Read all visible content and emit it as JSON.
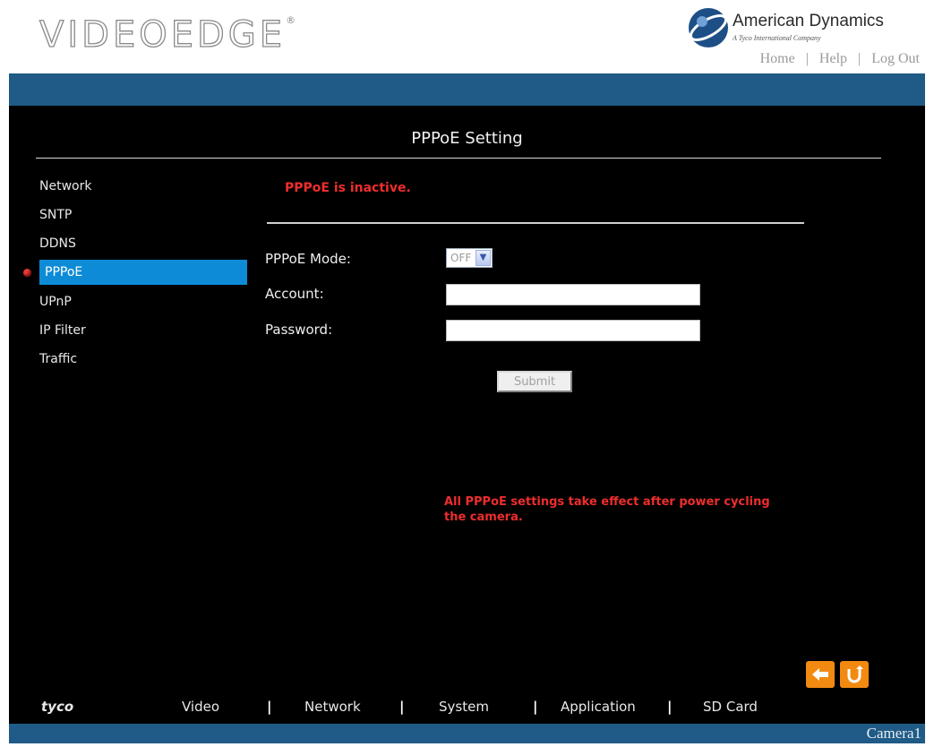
{
  "header": {
    "logo_text": "VIDEOEDGE",
    "logo_mark": "®",
    "brand_name": "American Dynamics",
    "brand_tagline": "A Tyco International Company",
    "emblem_icon": "american-dynamics-emblem-icon",
    "nav": [
      {
        "label": "Home"
      },
      {
        "label": "Help"
      },
      {
        "label": "Log Out"
      }
    ]
  },
  "page": {
    "title": "PPPoE Setting",
    "status_message": "PPPoE is inactive.",
    "note": "All PPPoE settings take effect after power cycling the camera."
  },
  "sidebar": {
    "active_index": 3,
    "items": [
      {
        "label": "Network"
      },
      {
        "label": "SNTP"
      },
      {
        "label": "DDNS"
      },
      {
        "label": "PPPoE"
      },
      {
        "label": "UPnP"
      },
      {
        "label": "IP Filter"
      },
      {
        "label": "Traffic"
      }
    ]
  },
  "form": {
    "mode_label": "PPPoE Mode:",
    "mode_value": "OFF",
    "account_label": "Account:",
    "account_value": "",
    "password_label": "Password:",
    "password_value": "",
    "submit_label": "Submit"
  },
  "controls": {
    "back_icon": "arrow-left-icon",
    "refresh_icon": "refresh-icon"
  },
  "footer": {
    "brand": "tyco",
    "nav": [
      {
        "label": "Video"
      },
      {
        "label": "Network"
      },
      {
        "label": "System"
      },
      {
        "label": "Application"
      },
      {
        "label": "SD Card"
      }
    ],
    "separator": "|",
    "camera_label": "Camera1"
  },
  "colors": {
    "accent_blue": "#1f5b86",
    "active_item": "#0e8bd6",
    "alert_red": "#ee2d2d",
    "control_orange": "#f28a12",
    "panel_black": "#000000"
  }
}
